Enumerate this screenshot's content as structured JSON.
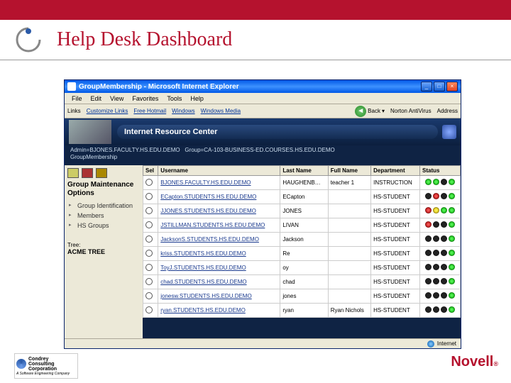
{
  "slide": {
    "title": "Help Desk Dashboard"
  },
  "window": {
    "title": "GroupMembership - Microsoft Internet Explorer",
    "menu": [
      "File",
      "Edit",
      "View",
      "Favorites",
      "Tools",
      "Help"
    ],
    "links_label": "Links",
    "toolbar_links": [
      "Customize Links",
      "Free Hotmail",
      "Windows",
      "Windows Media"
    ],
    "back": "Back",
    "norton": "Norton AntiVirus",
    "address": "Address"
  },
  "banner": {
    "title": "Internet Resource Center"
  },
  "breadcrumb": {
    "admin": "Admin=BJONES.FACULTY.HS.EDU.DEMO",
    "group": "Group=CA-103-BUSINESS-ED.COURSES.HS.EDU.DEMO",
    "section": "GroupMembership"
  },
  "sidebar": {
    "heading": "Group Maintenance Options",
    "items": [
      "Group Identification",
      "Members",
      "HS Groups"
    ],
    "tree_label": "Tree:",
    "tree_name": "ACME TREE"
  },
  "table": {
    "cols": [
      "Sel",
      "Username",
      "Last Name",
      "Full Name",
      "Department",
      "Status"
    ],
    "rows": [
      {
        "user": "BJONES.FACULTY.HS.EDU.DEMO",
        "last": "HAUGHENB…",
        "full": "teacher 1",
        "dept": "INSTRUCTION",
        "s": [
          "g",
          "g",
          "k",
          "g"
        ]
      },
      {
        "user": "ECapton.STUDENTS.HS.EDU.DEMO",
        "last": "ECapton",
        "full": "",
        "dept": "HS-STUDENT",
        "s": [
          "k",
          "r",
          "k",
          "g"
        ]
      },
      {
        "user": "JJONES.STUDENTS.HS.EDU.DEMO",
        "last": "JONES",
        "full": "",
        "dept": "HS-STUDENT",
        "s": [
          "r",
          "y",
          "g",
          "g"
        ]
      },
      {
        "user": "JSTILLMAN.STUDENTS.HS.EDU.DEMO",
        "last": "LIVAN",
        "full": "",
        "dept": "HS-STUDENT",
        "s": [
          "r",
          "k",
          "k",
          "g"
        ]
      },
      {
        "user": "JacksonS.STUDENTS.HS.EDU.DEMO",
        "last": "Jackson",
        "full": "",
        "dept": "HS-STUDENT",
        "s": [
          "k",
          "k",
          "k",
          "g"
        ]
      },
      {
        "user": "kriss.STUDENTS.HS.EDU.DEMO",
        "last": "Re",
        "full": "",
        "dept": "HS-STUDENT",
        "s": [
          "k",
          "k",
          "k",
          "g"
        ]
      },
      {
        "user": "ToyJ.STUDENTS.HS.EDU.DEMO",
        "last": "oy",
        "full": "",
        "dept": "HS-STUDENT",
        "s": [
          "k",
          "k",
          "k",
          "g"
        ]
      },
      {
        "user": "chad.STUDENTS.HS.EDU.DEMO",
        "last": "chad",
        "full": "",
        "dept": "HS-STUDENT",
        "s": [
          "k",
          "k",
          "k",
          "g"
        ]
      },
      {
        "user": "jonesw.STUDENTS.HS.EDU.DEMO",
        "last": "jones",
        "full": "",
        "dept": "HS-STUDENT",
        "s": [
          "k",
          "k",
          "k",
          "g"
        ]
      },
      {
        "user": "ryan.STUDENTS.HS.EDU.DEMO",
        "last": "ryan",
        "full": "Ryan Nichols",
        "dept": "HS-STUDENT",
        "s": [
          "k",
          "k",
          "k",
          "g"
        ]
      }
    ]
  },
  "statusbar": {
    "zone": "Internet"
  },
  "footer": {
    "condrey1": "Condrey",
    "condrey2": "Consulting",
    "condrey3": "Corporation",
    "condrey4": "A Software Engineering Company",
    "novell": "Novell"
  }
}
